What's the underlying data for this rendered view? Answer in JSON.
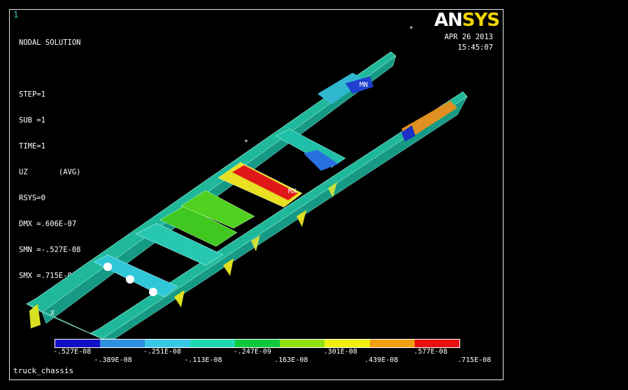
{
  "window": {
    "number": "1"
  },
  "logo": {
    "an": "AN",
    "sys": "SYS"
  },
  "header": {
    "date": "APR 26 2013",
    "time": "15:45:07"
  },
  "legend": {
    "line_title": "NODAL SOLUTION",
    "step": "STEP=1",
    "sub": "SUB =1",
    "time": "TIME=1",
    "result": "UZ       (AVG)",
    "rsys": "RSYS=0",
    "dmx": "DMX =.606E-07",
    "smn": "SMN =-.527E-08",
    "smx": "SMX =.715E-08"
  },
  "markers": {
    "mn": "MN",
    "mx": "MX",
    "x": "X",
    "star": "*"
  },
  "model_title": "truck_chassis",
  "contour": {
    "colors": [
      "#1010c8",
      "#2f8fe0",
      "#38c8e8",
      "#20d8b0",
      "#10c840",
      "#90e010",
      "#f0f010",
      "#f0a010",
      "#e81010"
    ],
    "labels_top": [
      "-.527E-08",
      "-.251E-08",
      "-.247E-09",
      ".301E-08",
      ".577E-08"
    ],
    "labels_bottom": [
      "-.389E-08",
      "-.113E-08",
      ".163E-08",
      ".439E-08",
      ".715E-08"
    ]
  }
}
